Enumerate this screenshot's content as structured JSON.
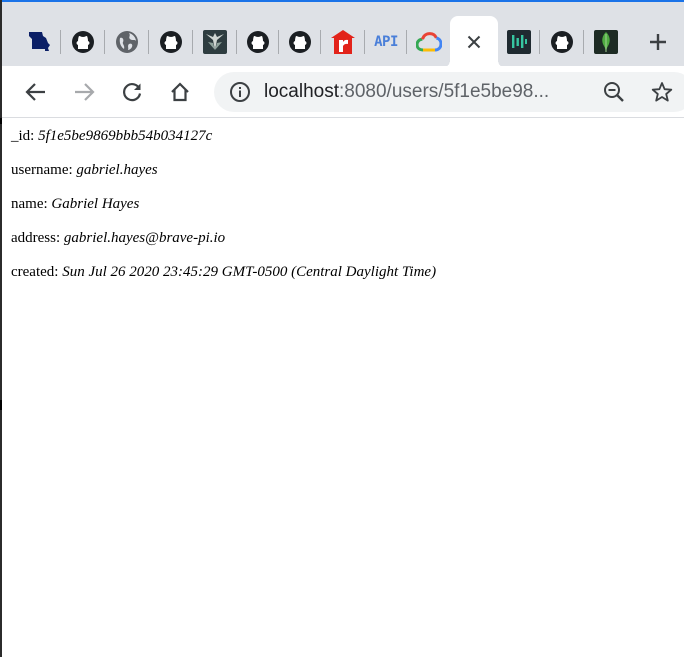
{
  "tabs": [
    {
      "icon": "missouri-state-icon"
    },
    {
      "icon": "github-icon"
    },
    {
      "icon": "globe-icon"
    },
    {
      "icon": "github-icon"
    },
    {
      "icon": "winged-logo-icon"
    },
    {
      "icon": "github-icon"
    },
    {
      "icon": "github-icon"
    },
    {
      "icon": "red-r-logo-icon"
    },
    {
      "icon": "api-icon",
      "label": "API"
    },
    {
      "icon": "google-cloud-icon"
    },
    {
      "icon": "close-icon",
      "active": true
    },
    {
      "icon": "teal-bars-icon"
    },
    {
      "icon": "github-icon"
    },
    {
      "icon": "mongodb-leaf-icon"
    }
  ],
  "new_tab": {
    "label": "+"
  },
  "address_bar": {
    "host": "localhost",
    "rest": ":8080/users/5f1e5be98..."
  },
  "colors": {
    "accent": "#1a73e8",
    "tabstrip": "#dee1e6",
    "omnibox": "#f1f3f4"
  },
  "user": {
    "id": {
      "label": "_id:",
      "value": "5f1e5be9869bbb54b034127c"
    },
    "username": {
      "label": "username:",
      "value": "gabriel.hayes"
    },
    "name": {
      "label": "name:",
      "value": "Gabriel Hayes"
    },
    "address": {
      "label": "address:",
      "value": "gabriel.hayes@brave-pi.io"
    },
    "created": {
      "label": "created:",
      "value": "Sun Jul 26 2020 23:45:29 GMT-0500 (Central Daylight Time)"
    }
  }
}
